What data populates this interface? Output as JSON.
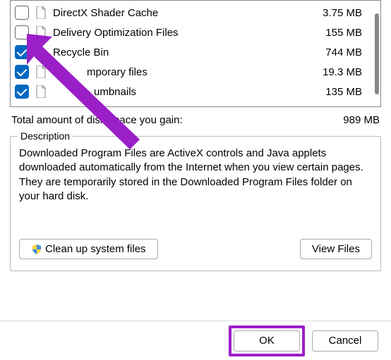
{
  "files": [
    {
      "checked": false,
      "icon": "page",
      "name": "DirectX Shader Cache",
      "size": "3.75 MB"
    },
    {
      "checked": false,
      "icon": "page",
      "name": "Delivery Optimization Files",
      "size": "155 MB"
    },
    {
      "checked": true,
      "icon": "recycle",
      "name": "Recycle Bin",
      "size": "744 MB"
    },
    {
      "checked": true,
      "icon": "page",
      "name": "Temporary files",
      "size": "19.3 MB"
    },
    {
      "checked": true,
      "icon": "page",
      "name": "Thumbnails",
      "size": "135 MB"
    }
  ],
  "arrow_obscured": [
    "Temporary files",
    "Thumbnails"
  ],
  "total": {
    "label": "Total amount of disk space you gain:",
    "label_visible": "Total amount of  isk space you gain:",
    "value": "989 MB"
  },
  "description": {
    "legend": "Description",
    "text": "Downloaded Program Files are ActiveX controls and Java applets downloaded automatically from the Internet when you view certain pages. They are temporarily stored in the Downloaded Program Files folder on your hard disk."
  },
  "buttons": {
    "cleanup": "Clean up system files",
    "view": "View Files",
    "ok": "OK",
    "cancel": "Cancel"
  },
  "annotation": {
    "arrow_color": "#9a1fc7"
  }
}
